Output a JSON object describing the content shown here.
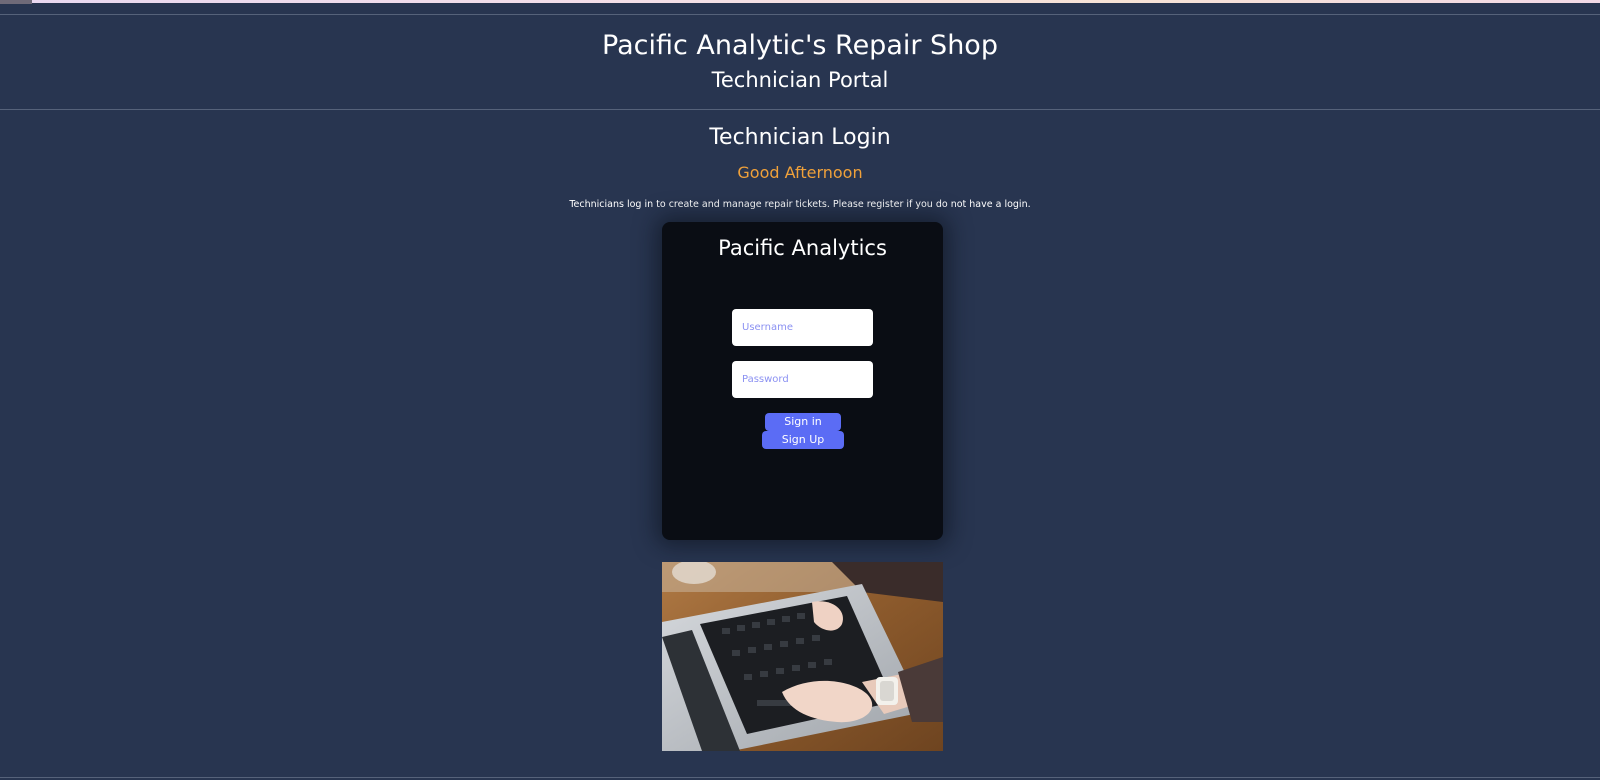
{
  "header": {
    "shop_title": "Pacific Analytic's Repair Shop",
    "portal_title": "Technician Portal"
  },
  "main": {
    "login_heading": "Technician Login",
    "greeting": "Good Afternoon",
    "intro": "Technicians log in to create and manage repair tickets. Please register if you do not have a login."
  },
  "login_card": {
    "brand": "Pacific Analytics",
    "username_placeholder": "Username",
    "password_placeholder": "Password",
    "signin_label": "Sign in",
    "signup_label": "Sign Up"
  },
  "colors": {
    "background": "#283550",
    "card": "#0a0d14",
    "accent_button": "#5b6cf5",
    "greeting": "#f0a13a"
  }
}
